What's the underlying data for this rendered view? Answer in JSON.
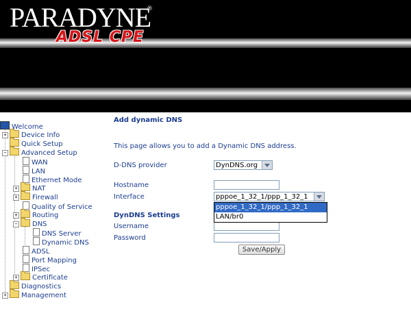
{
  "header": {
    "brand": "PARADYNE",
    "registered_mark": "®",
    "product": "ADSL CPE"
  },
  "sidebar": {
    "items": [
      {
        "label": "Welcome"
      },
      {
        "label": "Device Info"
      },
      {
        "label": "Quick Setup"
      },
      {
        "label": "Advanced Setup"
      },
      {
        "label": "WAN"
      },
      {
        "label": "LAN"
      },
      {
        "label": "Ethernet Mode"
      },
      {
        "label": "NAT"
      },
      {
        "label": "Firewall"
      },
      {
        "label": "Quality of Service"
      },
      {
        "label": "Routing"
      },
      {
        "label": "DNS"
      },
      {
        "label": "DNS Server"
      },
      {
        "label": "Dynamic DNS"
      },
      {
        "label": "ADSL"
      },
      {
        "label": "Port Mapping"
      },
      {
        "label": "IPSec"
      },
      {
        "label": "Certificate"
      },
      {
        "label": "Diagnostics"
      },
      {
        "label": "Management"
      }
    ]
  },
  "main": {
    "title": "Add dynamic DNS",
    "intro": "This page allows you to add a Dynamic DNS address.",
    "provider_label": "D-DNS provider",
    "provider_value": "DynDNS.org",
    "hostname_label": "Hostname",
    "hostname_value": "",
    "interface_label": "Interface",
    "interface_value": "pppoe_1_32_1/ppp_1_32_1",
    "interface_options": [
      "pppoe_1_32_1/ppp_1_32_1",
      "LAN/br0"
    ],
    "settings_heading": "DynDNS Settings",
    "username_label": "Username",
    "username_value": "",
    "password_label": "Password",
    "password_value": "",
    "save_label": "Save/Apply"
  },
  "colors": {
    "link": "#1a3c8f",
    "brand_red": "#d8151a",
    "selection": "#316ac5"
  }
}
